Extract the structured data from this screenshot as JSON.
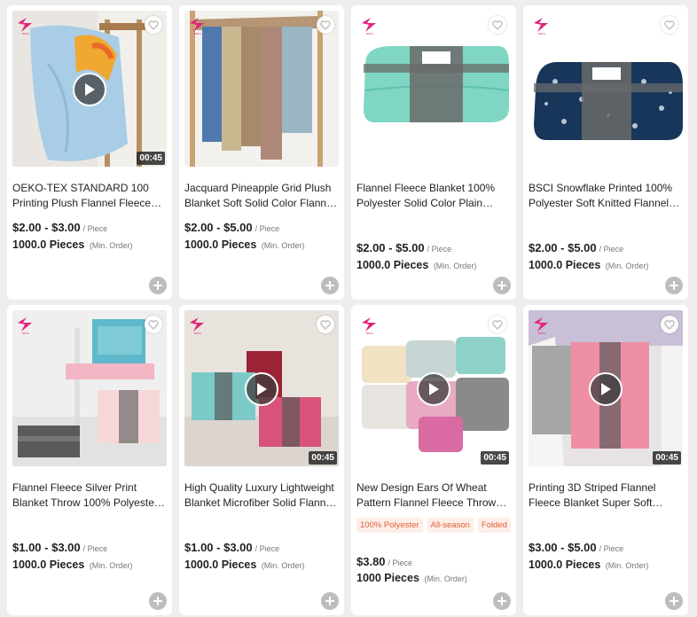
{
  "colors": {
    "brand": "#e2247a",
    "tag_text": "#e0603a",
    "tag_bg": "#fdeee8"
  },
  "icons": {
    "brand": "brand-logo-icon",
    "favorite": "heart-icon",
    "play": "play-icon",
    "add": "plus-icon"
  },
  "products": [
    {
      "title_line1": "OEKO-TEX STANDARD 100",
      "title_line2": "Printing Plush Flannel Fleece…",
      "price": "$2.00 - $3.00",
      "price_unit": "/ Piece",
      "moq": "1000.0 Pieces",
      "moq_note": "(Min. Order)",
      "duration": "00:45",
      "tags": []
    },
    {
      "title_line1": "Jacquard Pineapple Grid Plush",
      "title_line2": "Blanket Soft Solid Color Flann…",
      "price": "$2.00 - $5.00",
      "price_unit": "/ Piece",
      "moq": "1000.0 Pieces",
      "moq_note": "(Min. Order)",
      "duration": "",
      "tags": []
    },
    {
      "title_line1": "Flannel Fleece Blanket 100%",
      "title_line2": "Polyester Solid Color Plain…",
      "price": "$2.00 - $5.00",
      "price_unit": "/ Piece",
      "moq": "1000.0 Pieces",
      "moq_note": "(Min. Order)",
      "duration": "",
      "tags": []
    },
    {
      "title_line1": "BSCI Snowflake Printed 100%",
      "title_line2": "Polyester Soft Knitted Flannel…",
      "price": "$2.00 - $5.00",
      "price_unit": "/ Piece",
      "moq": "1000.0 Pieces",
      "moq_note": "(Min. Order)",
      "duration": "",
      "tags": []
    },
    {
      "title_line1": "Flannel Fleece Silver Print",
      "title_line2": "Blanket Throw 100% Polyeste…",
      "price": "$1.00 - $3.00",
      "price_unit": "/ Piece",
      "moq": "1000.0 Pieces",
      "moq_note": "(Min. Order)",
      "duration": "",
      "tags": []
    },
    {
      "title_line1": "High Quality Luxury Lightweight",
      "title_line2": "Blanket Microfiber Solid Flann…",
      "price": "$1.00 - $3.00",
      "price_unit": "/ Piece",
      "moq": "1000.0 Pieces",
      "moq_note": "(Min. Order)",
      "duration": "00:45",
      "tags": []
    },
    {
      "title_line1": "New Design Ears Of Wheat",
      "title_line2": "Pattern Flannel Fleece Throw…",
      "price": "$3.80",
      "price_unit": "/ Piece",
      "moq": "1000 Pieces",
      "moq_note": "(Min. Order)",
      "duration": "00:45",
      "tags": [
        "100% Polyester",
        "All-season",
        "Folded"
      ]
    },
    {
      "title_line1": "Printing 3D Striped Flannel",
      "title_line2": "Fleece Blanket Super Soft…",
      "price": "$3.00 - $5.00",
      "price_unit": "/ Piece",
      "moq": "1000.0 Pieces",
      "moq_note": "(Min. Order)",
      "duration": "00:45",
      "tags": []
    }
  ]
}
